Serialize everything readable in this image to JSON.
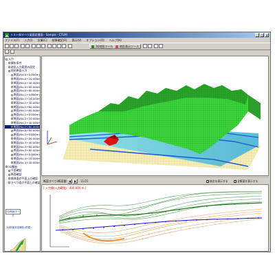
{
  "window": {
    "title": "ミスト斜すべり図面定盤面 - Sample - CTLMI",
    "controls": {
      "minimize": "_",
      "maximize": "□",
      "close": "×"
    }
  },
  "menu": [
    "ファイル(F)",
    "入力(I)",
    "計算(C)",
    "結果確認(R)",
    "表示(V)",
    "オプション(O)",
    "ヘルプ(H)"
  ],
  "toolbar": {
    "tool_a_label": "3D地形ツール",
    "tool_b_label": "地形表示ツール"
  },
  "tree": {
    "items": [
      {
        "label": "入力",
        "level": 0
      },
      {
        "label": "解析条件",
        "level": 1
      },
      {
        "label": "地形入力範囲の設定",
        "level": 1
      },
      {
        "label": "地形断面入力",
        "level": 1
      },
      {
        "label": "断面(No.0+0.000m)",
        "level": 2
      },
      {
        "label": "断面(No.0+20.000m)",
        "level": 2
      },
      {
        "label": "断面(No.0+40.000m)",
        "level": 2
      },
      {
        "label": "断面(No.0+60.000m)",
        "level": 2
      },
      {
        "label": "断面(No.0+80.000m)",
        "level": 2
      },
      {
        "label": "断面(No.1+0.000m)",
        "level": 2
      },
      {
        "label": "断面(No.1+20.000m)",
        "level": 2
      },
      {
        "label": "断面(No.1+40.000m)",
        "level": 2
      },
      {
        "label": "断面(No.1+60.000m)",
        "level": 2
      },
      {
        "label": "断面(No.1+80.000m)",
        "level": 2
      },
      {
        "label": "断面(No.2+0.000m)",
        "level": 2
      },
      {
        "label": "断面(No.2+20.000m)",
        "level": 2
      },
      {
        "label": "断面(No.2+40.000m)",
        "level": 2
      },
      {
        "label": "断面(No.2+60.000m)",
        "level": 2,
        "selected": true
      },
      {
        "label": "断面(No.2+80.000m)",
        "level": 2
      },
      {
        "label": "断面(No.3+0.000m)",
        "level": 2
      },
      {
        "label": "断面(No.3+20.000m)",
        "level": 2
      },
      {
        "label": "断面(No.3+40.000m)",
        "level": 2
      },
      {
        "label": "断面(No.3+60.000m)",
        "level": 2
      },
      {
        "label": "断面(No.3+80.000m)",
        "level": 2
      },
      {
        "label": "断面(No.4+0.000m)",
        "level": 2
      },
      {
        "label": "断面(No.4+20.000m)",
        "level": 2
      },
      {
        "label": "断面(No.4+40.000m)",
        "level": 2
      },
      {
        "label": "3D解析",
        "level": 0
      },
      {
        "label": "平面確認",
        "level": 1
      },
      {
        "label": "断面確認",
        "level": 1
      },
      {
        "label": "推移面の平面上の確認",
        "level": 1
      },
      {
        "label": "すべり面の平面上の確認",
        "level": 1
      }
    ],
    "tab_label": "3D斜面すべり",
    "caption": "3D斜面安定解析(簡易)"
  },
  "section": {
    "bar_label": "断面すべり(断面番号)",
    "prev_label": "◀",
    "next_label": "▶",
    "page": "11/21",
    "check1_label": "格点を表示する",
    "check2_label": "全断面を表示する",
    "header": "[ 入力値(入力範囲) : 400.000 m ]"
  },
  "colors": {
    "terrain": "#33cc33",
    "water": "#55c8e8",
    "base": "#f2e8a8",
    "slide": "#dd1111",
    "title_blue": "#0a246a"
  }
}
